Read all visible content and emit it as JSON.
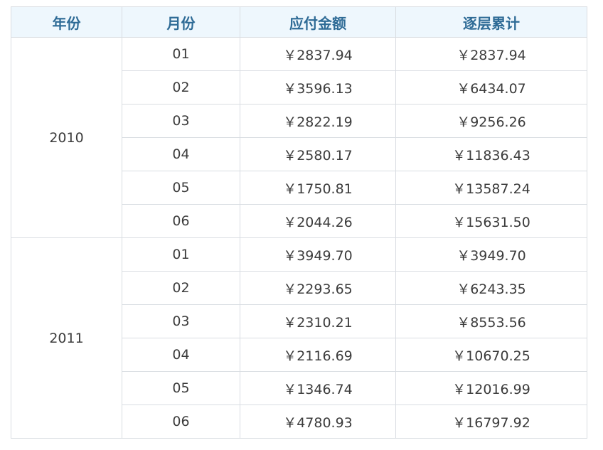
{
  "table": {
    "headers": [
      "年份",
      "月份",
      "应付金额",
      "逐层累计"
    ],
    "groups": [
      {
        "year": "2010",
        "rows": [
          {
            "month": "01",
            "amount": "￥2837.94",
            "cumulative": "￥2837.94"
          },
          {
            "month": "02",
            "amount": "￥3596.13",
            "cumulative": "￥6434.07"
          },
          {
            "month": "03",
            "amount": "￥2822.19",
            "cumulative": "￥9256.26"
          },
          {
            "month": "04",
            "amount": "￥2580.17",
            "cumulative": "￥11836.43"
          },
          {
            "month": "05",
            "amount": "￥1750.81",
            "cumulative": "￥13587.24"
          },
          {
            "month": "06",
            "amount": "￥2044.26",
            "cumulative": "￥15631.50"
          }
        ]
      },
      {
        "year": "2011",
        "rows": [
          {
            "month": "01",
            "amount": "￥3949.70",
            "cumulative": "￥3949.70"
          },
          {
            "month": "02",
            "amount": "￥2293.65",
            "cumulative": "￥6243.35"
          },
          {
            "month": "03",
            "amount": "￥2310.21",
            "cumulative": "￥8553.56"
          },
          {
            "month": "04",
            "amount": "￥2116.69",
            "cumulative": "￥10670.25"
          },
          {
            "month": "05",
            "amount": "￥1346.74",
            "cumulative": "￥12016.99"
          },
          {
            "month": "06",
            "amount": "￥4780.93",
            "cumulative": "￥16797.92"
          }
        ]
      }
    ]
  },
  "colors": {
    "header_bg": "#eef7fd",
    "header_text": "#2e6b96",
    "border": "#d9dde2",
    "body_text": "#3c3c3c"
  }
}
